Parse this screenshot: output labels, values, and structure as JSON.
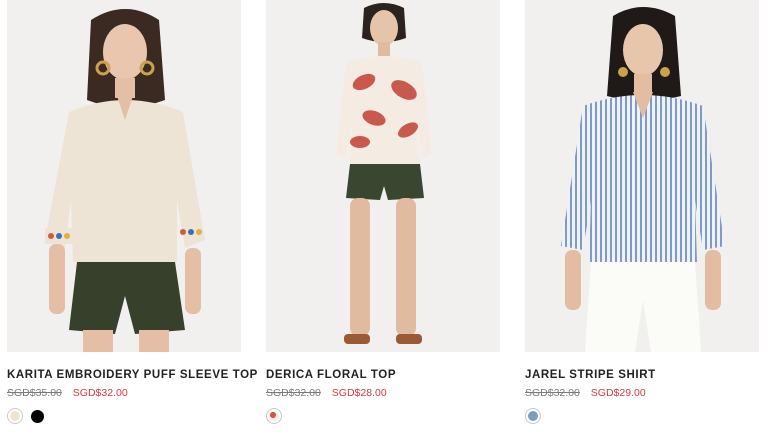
{
  "products": [
    {
      "name": "KARITA EMBROIDERY PUFF SLEEVE TOP",
      "old_price": "SGD$35.00",
      "new_price": "SGD$32.00",
      "swatches": [
        "#efe3d2",
        "#000000"
      ]
    },
    {
      "name": "DERICA FLORAL TOP",
      "old_price": "SGD$32.00",
      "new_price": "SGD$28.00",
      "swatches": [
        "#e8b8a8"
      ]
    },
    {
      "name": "JAREL STRIPE SHIRT",
      "old_price": "SGD$32.00",
      "new_price": "SGD$29.00",
      "swatches": [
        "#7f9ac4"
      ]
    }
  ],
  "colors": {
    "sale_price": "#d9373c",
    "old_price": "#7a7a7a",
    "title": "#222222"
  }
}
